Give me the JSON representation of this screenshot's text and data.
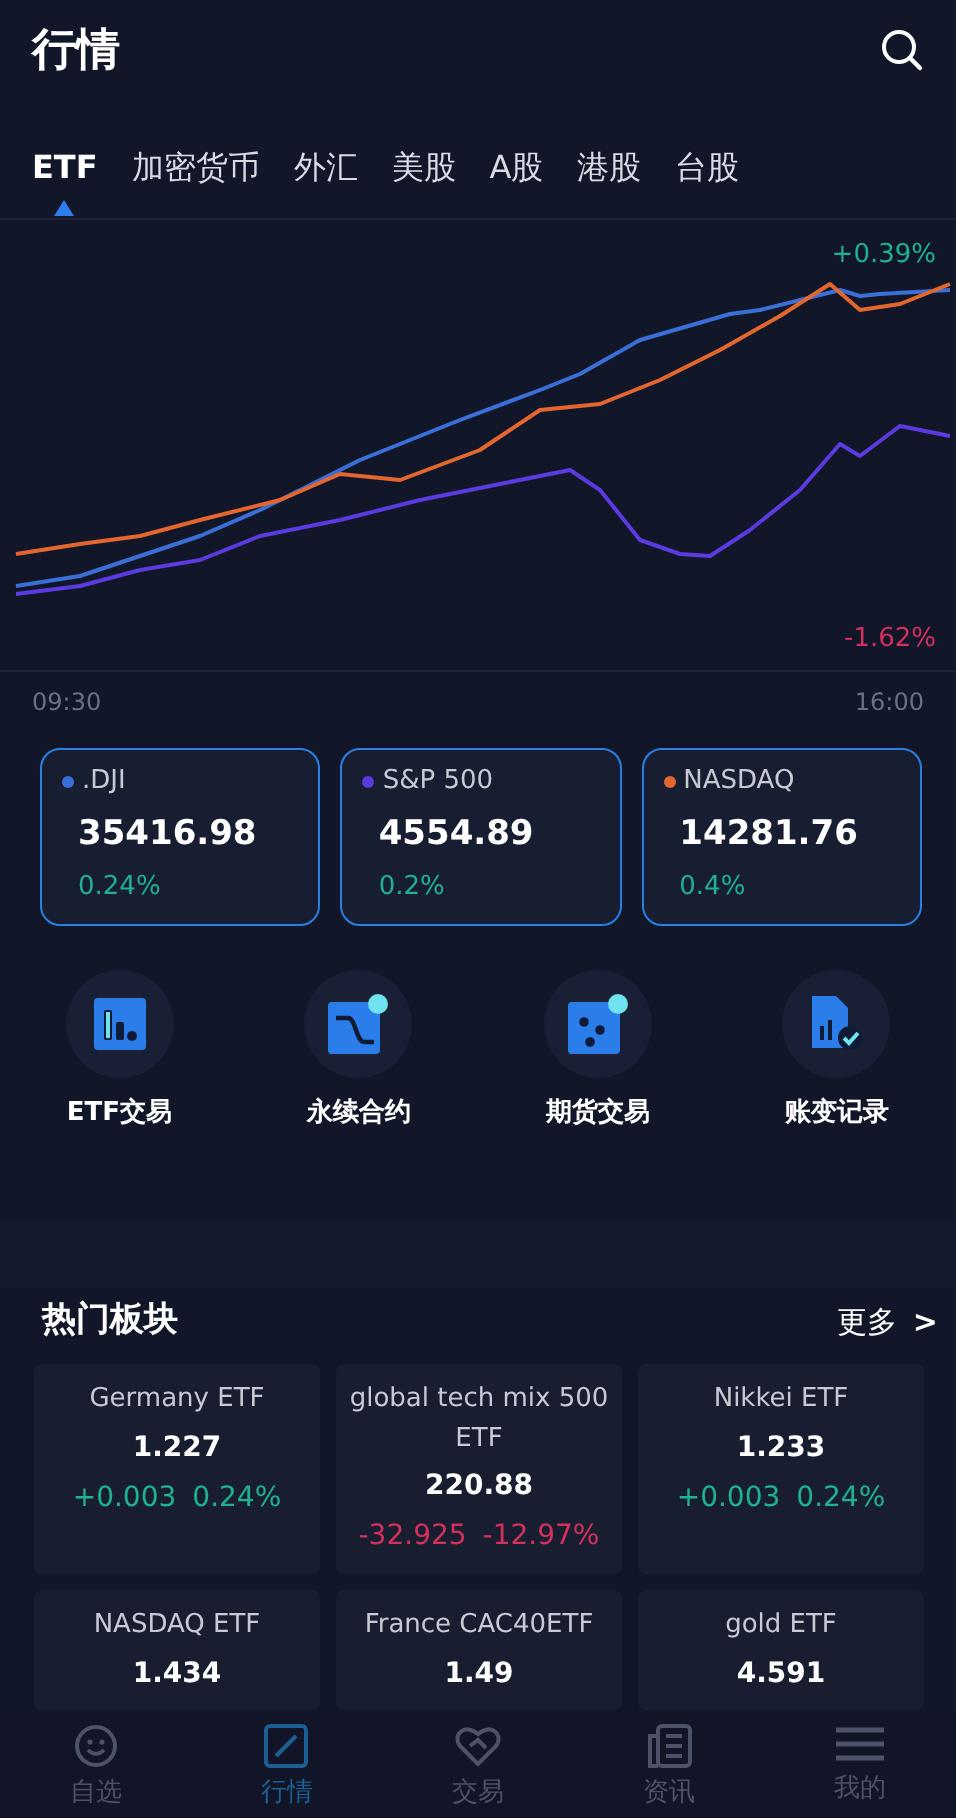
{
  "header": {
    "title": "行情"
  },
  "tabs": [
    {
      "label": "ETF",
      "selected": true
    },
    {
      "label": "加密货币",
      "selected": false
    },
    {
      "label": "外汇",
      "selected": false
    },
    {
      "label": "美股",
      "selected": false
    },
    {
      "label": "A股",
      "selected": false
    },
    {
      "label": "港股",
      "selected": false
    },
    {
      "label": "台股",
      "selected": false
    }
  ],
  "chart": {
    "high_label": "+0.39%",
    "low_label": "-1.62%",
    "start_time": "09:30",
    "end_time": "16:00"
  },
  "indices": [
    {
      "name": ".DJI",
      "color": "#3a6fd8",
      "price": "35416.98",
      "change": "0.24%"
    },
    {
      "name": "S&P 500",
      "color": "#5b3be0",
      "price": "4554.89",
      "change": "0.2%"
    },
    {
      "name": "NASDAQ",
      "color": "#e4662f",
      "price": "14281.76",
      "change": "0.4%"
    }
  ],
  "shortcuts": [
    {
      "kind": "bars",
      "label": "ETF交易"
    },
    {
      "kind": "curve",
      "label": "永续合约"
    },
    {
      "kind": "dots",
      "label": "期货交易"
    },
    {
      "kind": "document",
      "label": "账变记录"
    }
  ],
  "hot": {
    "title": "热门板块",
    "more": "更多",
    "more_icon": ">",
    "items": [
      {
        "name": "Germany ETF",
        "price": "1.227",
        "change": "+0.003",
        "percent": "0.24%",
        "color": "#1fb190"
      },
      {
        "name": "global tech mix 500 ETF",
        "price": "220.88",
        "change": "-32.925",
        "percent": "-12.97%",
        "color": "#d3305e"
      },
      {
        "name": "Nikkei ETF",
        "price": "1.233",
        "change": "+0.003",
        "percent": "0.24%",
        "color": "#1fb190"
      },
      {
        "name": "NASDAQ ETF",
        "price": "1.434"
      },
      {
        "name": "France CAC40ETF",
        "price": "1.49"
      },
      {
        "name": "gold ETF",
        "price": "4.591"
      }
    ]
  },
  "nav": [
    {
      "kind": "smile",
      "label": "自选",
      "selected": false
    },
    {
      "kind": "chart",
      "label": "行情",
      "selected": true
    },
    {
      "kind": "heart",
      "label": "交易",
      "selected": false
    },
    {
      "kind": "news",
      "label": "资讯",
      "selected": false
    },
    {
      "kind": "menu",
      "label": "我的",
      "selected": false
    }
  ]
}
